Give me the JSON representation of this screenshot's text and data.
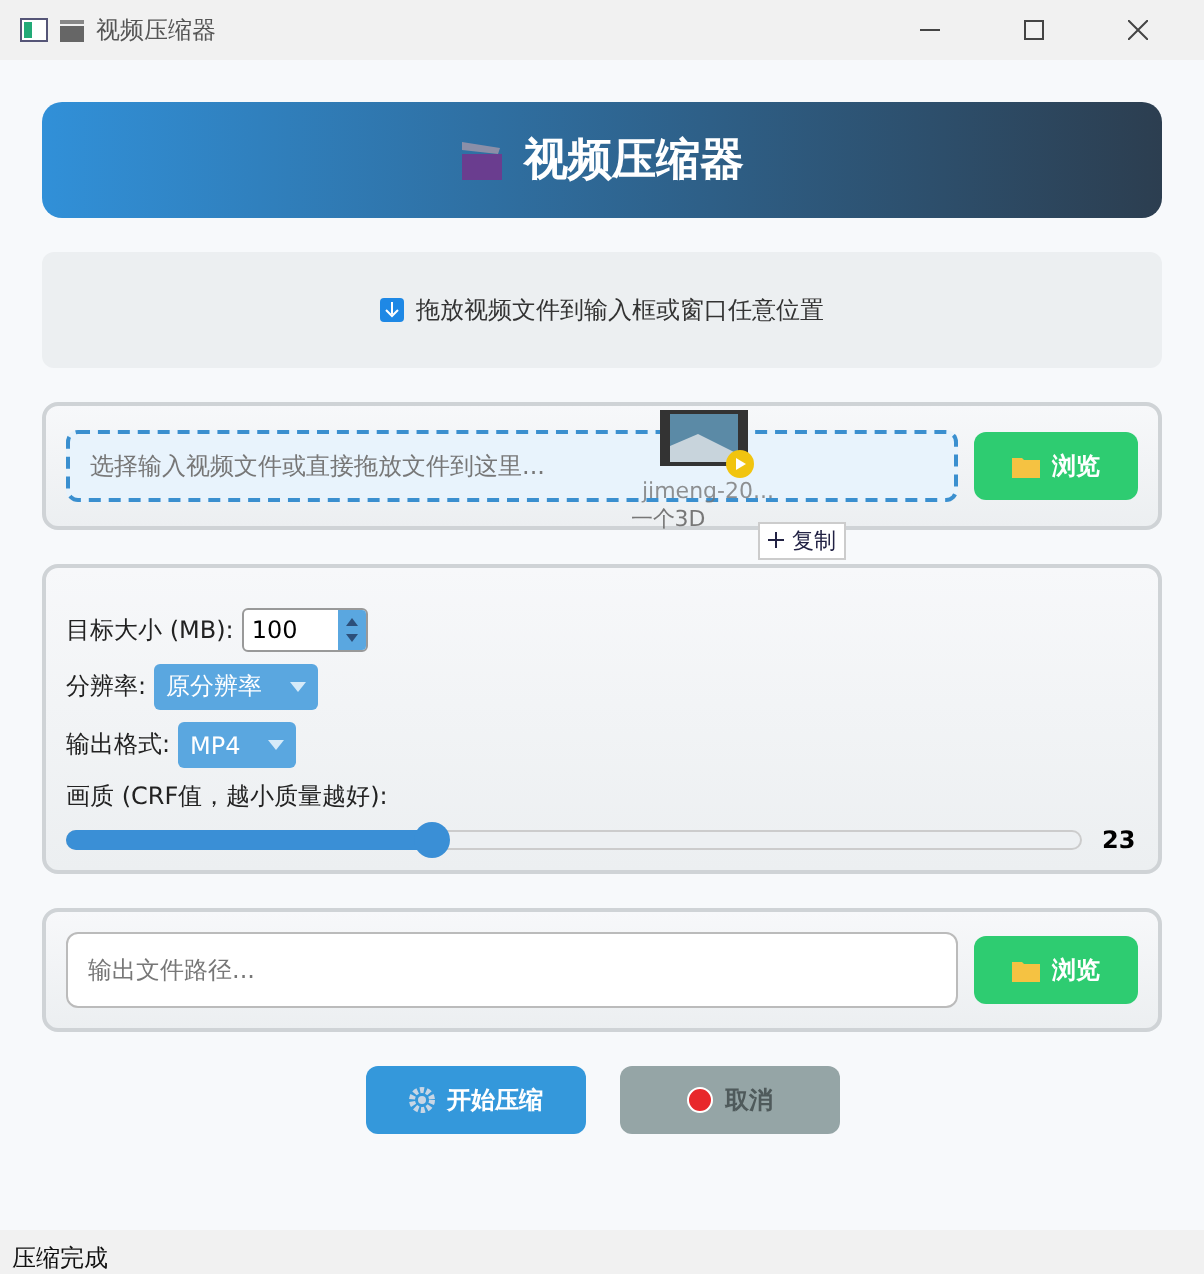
{
  "window": {
    "title": "视频压缩器"
  },
  "header": {
    "title": "视频压缩器"
  },
  "hint": {
    "text": "拖放视频文件到输入框或窗口任意位置"
  },
  "input": {
    "placeholder": "选择输入视频文件或直接拖放文件到这里...",
    "browse": "浏览"
  },
  "drag_ghost": {
    "file_name": "jimeng-20...",
    "caption": "一个3D",
    "tooltip": "复制"
  },
  "settings": {
    "size_label": "目标大小 (MB):",
    "size_value": "100",
    "resolution_label": "分辨率:",
    "resolution_value": "原分辨率",
    "format_label": "输出格式:",
    "format_value": "MP4",
    "quality_label": "画质 (CRF值，越小质量越好):",
    "quality": {
      "level": 0.36,
      "reading": "23"
    }
  },
  "output": {
    "placeholder": "输出文件路径...",
    "browse": "浏览"
  },
  "actions": [
    {
      "kind": "start",
      "label": "开始压缩",
      "disabled": false
    },
    {
      "kind": "cancel",
      "label": "取消",
      "disabled": true
    }
  ],
  "status_bar": "压缩完成"
}
